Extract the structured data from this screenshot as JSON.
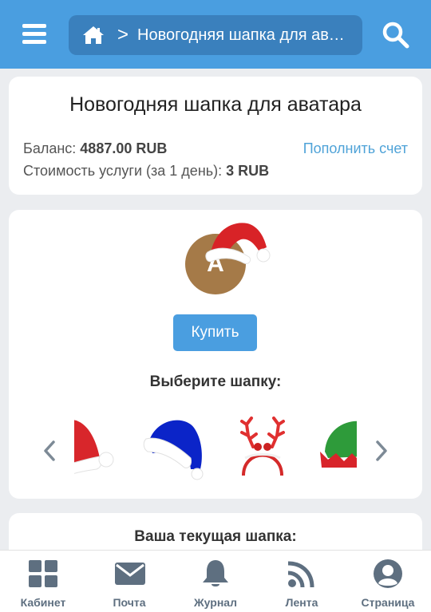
{
  "header": {
    "breadcrumb_separator": ">",
    "breadcrumb_title": "Новогодняя шапка для ава...",
    "icons": [
      "menu-icon",
      "home-icon",
      "search-icon"
    ]
  },
  "info": {
    "title": "Новогодняя шапка для аватара",
    "balance_label": "Баланс:",
    "balance_value": "4887.00 RUB",
    "topup_link": "Пополнить счет",
    "cost_label": "Стоимость услуги (за 1 день):",
    "cost_value": "3 RUB"
  },
  "preview": {
    "avatar_letter": "А",
    "avatar_color": "#a57a48",
    "buy_label": "Купить",
    "choose_label": "Выберите шапку:",
    "hats": [
      "red-santa-hat",
      "blue-santa-hat",
      "reindeer-antlers-headband",
      "green-elf-hat"
    ]
  },
  "current": {
    "label": "Ваша текущая шапка:"
  },
  "bottom_nav": [
    {
      "label": "Кабинет",
      "icon": "grid-icon"
    },
    {
      "label": "Почта",
      "icon": "mail-icon"
    },
    {
      "label": "Журнал",
      "icon": "bell-icon"
    },
    {
      "label": "Лента",
      "icon": "rss-icon"
    },
    {
      "label": "Страница",
      "icon": "user-icon"
    }
  ],
  "colors": {
    "accent": "#4a9ee0",
    "breadcrumb_bg": "#3a80bd",
    "link": "#4fa3d8",
    "nav_icon": "#5e6f80"
  }
}
